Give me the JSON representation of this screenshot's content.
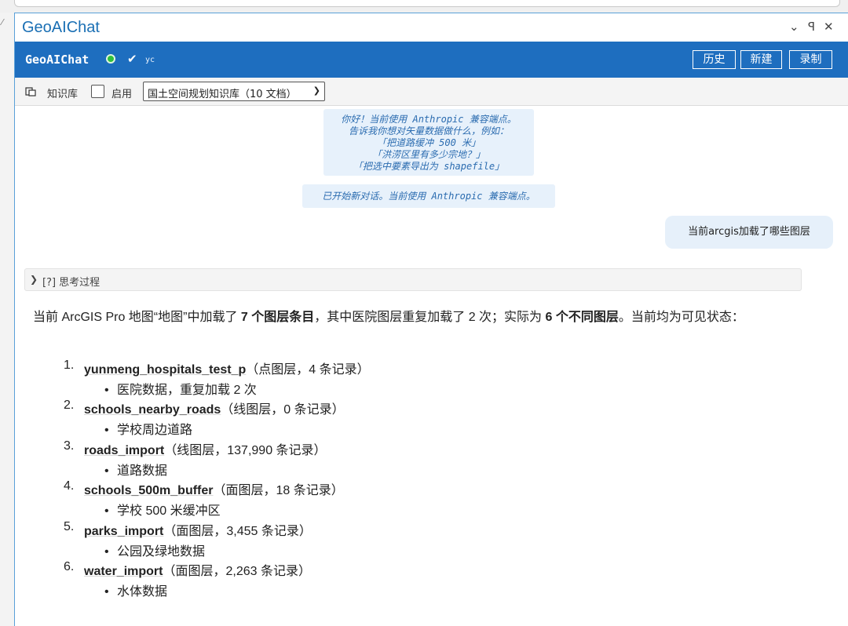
{
  "pane": {
    "title": "GeoAIChat",
    "controls": [
      "⌄",
      "ꟼ",
      "✕"
    ]
  },
  "header": {
    "app_name": "GeoAIChat",
    "user": "yc",
    "history_label": "历史",
    "new_label": "新建",
    "record_label": "录制",
    "colors": {
      "bar": "#1e6ebf",
      "status_dot": "#2fc13b"
    }
  },
  "toolbar": {
    "kb_label": "知识库",
    "enable_label": "启用",
    "enabled": false,
    "kb_select_value": "国土空间规划知识库（10 文档）"
  },
  "chat": {
    "welcome_lines": [
      "你好！当前使用 Anthropic 兼容端点。",
      "告诉我你想对矢量数据做什么，例如：",
      "「把道路缓冲 500 米」",
      "「洪涝区里有多少宗地？」",
      "「把选中要素导出为 shapefile」"
    ],
    "new_chat_notice": "已开始新对话。当前使用 Anthropic 兼容端点。",
    "user_message": "当前arcgis加载了哪些图层",
    "thinking_label": "[?] 思考过程",
    "answer": {
      "intro_a": "当前 ArcGIS Pro 地图“地图”中加载了 ",
      "intro_b": "7 个图层条目",
      "intro_c": "，其中医院图层重复加载了 2 次；实际为 ",
      "intro_d": "6 个不同图层",
      "intro_e": "。当前均为可见状态：",
      "layers": [
        {
          "num": "1.",
          "name": "yunmeng_hospitals_test_p",
          "meta": "（点图层，4 条记录）",
          "note": "医院数据，重复加载 2 次"
        },
        {
          "num": "2.",
          "name": "schools_nearby_roads",
          "meta": "（线图层，0 条记录）",
          "note": "学校周边道路"
        },
        {
          "num": "3.",
          "name": "roads_import",
          "meta": "（线图层，137,990 条记录）",
          "note": "道路数据"
        },
        {
          "num": "4.",
          "name": "schools_500m_buffer",
          "meta": "（面图层，18 条记录）",
          "note": "学校 500 米缓冲区"
        },
        {
          "num": "5.",
          "name": "parks_import",
          "meta": "（面图层，3,455 条记录）",
          "note": "公园及绿地数据"
        },
        {
          "num": "6.",
          "name": "water_import",
          "meta": "（面图层，2,263 条记录）",
          "note": "水体数据"
        }
      ]
    }
  }
}
